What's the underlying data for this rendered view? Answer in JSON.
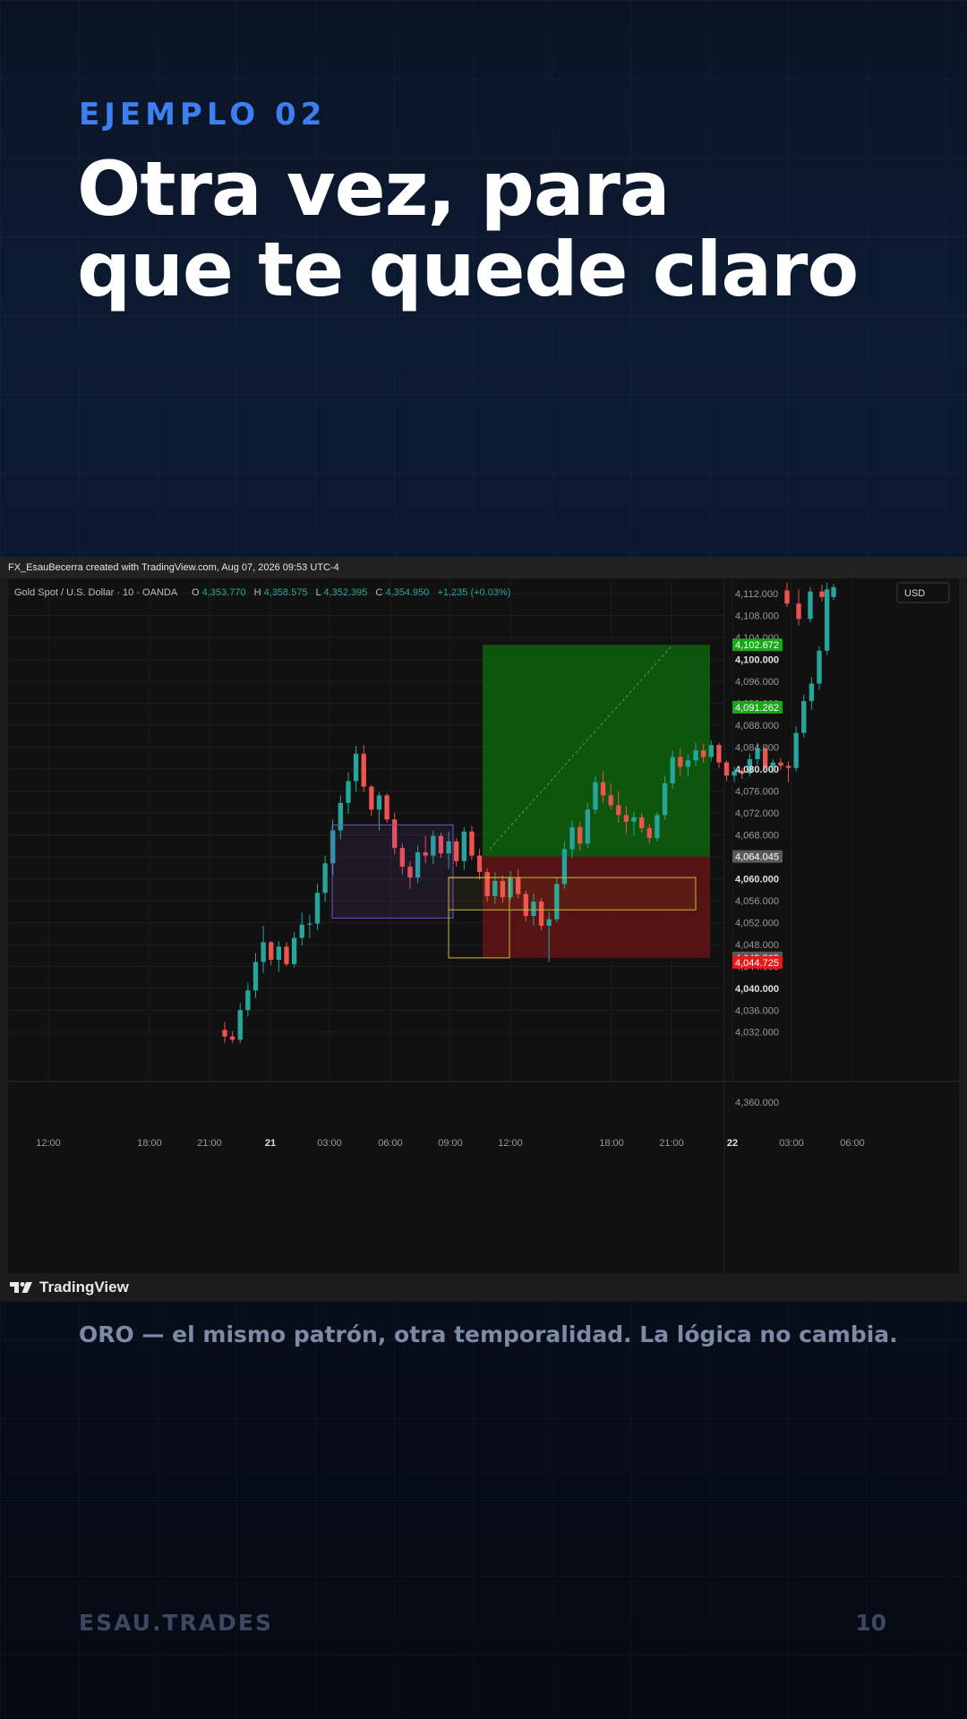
{
  "eyebrow": "EJEMPLO 02",
  "title": {
    "line1": "Otra vez, para",
    "line2": "que te quede claro"
  },
  "caption": "ORO — el mismo patrón, otra temporalidad. La lógica no cambia.",
  "footer": {
    "brand": "ESAU.TRADES",
    "page": "10"
  },
  "tradingview": {
    "created_line": "FX_EsauBecerra created with TradingView.com, Aug 07, 2026 09:53 UTC-4",
    "symbol": "Gold Spot / U.S. Dollar · 10 · OANDA",
    "ohlc": {
      "o_label": "O",
      "o": "4,353.770",
      "h_label": "H",
      "h": "4,358.575",
      "l_label": "L",
      "l": "4,352.395",
      "c_label": "C",
      "c": "4,354.950",
      "change": "+1.235 (+0.03%)"
    },
    "currency": "USD",
    "logo_text": "TradingView",
    "price_axis": [
      "4,112.000",
      "4,108.000",
      "4,104.000",
      "4,100.000",
      "4,096.000",
      "4,092.000",
      "4,088.000",
      "4,084.000",
      "4,080.000",
      "4,076.000",
      "4,072.000",
      "4,068.000",
      "4,064.000",
      "4,060.000",
      "4,056.000",
      "4,052.000",
      "4,048.000",
      "4,044.000",
      "4,040.000",
      "4,036.000",
      "4,032.000"
    ],
    "lower_axis_price": "4,360.000",
    "price_tags": [
      {
        "label": "4,102.672",
        "color": "#1aa81a"
      },
      {
        "label": "4,091.262",
        "color": "#1aa81a"
      },
      {
        "label": "4,064.045",
        "color": "#5a5a5a"
      },
      {
        "label": "4,045.535",
        "color": "#5a5a5a"
      },
      {
        "label": "4,044.725",
        "color": "#e8191a"
      }
    ],
    "time_axis": [
      "12:00",
      "18:00",
      "21:00",
      "21",
      "03:00",
      "06:00",
      "09:00",
      "12:00",
      "18:00",
      "21:00",
      "22",
      "03:00",
      "06:00"
    ],
    "colors": {
      "up": "#26a69a",
      "down": "#ef5350",
      "profit_zone": "#0f5a0f",
      "loss_zone": "#5a1414",
      "range_box": "#7b4fc9",
      "fvg_box": "#c9b74a"
    }
  },
  "chart_data": {
    "type": "candlestick",
    "symbol": "Gold Spot / U.S. Dollar",
    "timeframe": "10",
    "ylim": [
      4030,
      4114
    ],
    "x_ticks": [
      "12:00",
      "18:00",
      "21:00",
      "21",
      "03:00",
      "06:00",
      "09:00",
      "12:00",
      "18:00",
      "21:00",
      "22",
      "03:00",
      "06:00"
    ],
    "position": {
      "entry": 4064.045,
      "take_profit": 4102.672,
      "stop_loss": 4045.535
    },
    "range_box": {
      "high": 4069.8,
      "low": 4052.8
    },
    "fvg_box": {
      "high": 4060.2,
      "low": 4054.3
    },
    "candles": [
      [
        4032.4,
        4033.8,
        4030,
        4031.2
      ],
      [
        4031.2,
        4032.2,
        4030,
        4030.6
      ],
      [
        4030.6,
        4037.2,
        4030,
        4036
      ],
      [
        4036,
        4041,
        4034.8,
        4039.6
      ],
      [
        4039.6,
        4046.4,
        4038.2,
        4044.8
      ],
      [
        4044.8,
        4051.4,
        4042.8,
        4048.4
      ],
      [
        4048.4,
        4048.6,
        4044.2,
        4045.2
      ],
      [
        4045.2,
        4048.6,
        4043,
        4047.6
      ],
      [
        4047.6,
        4048.4,
        4044,
        4044.4
      ],
      [
        4044.4,
        4050.2,
        4043.8,
        4049.2
      ],
      [
        4049.2,
        4053.8,
        4047.8,
        4051.6
      ],
      [
        4051.6,
        4053.4,
        4049.2,
        4051.8
      ],
      [
        4051.8,
        4059,
        4050.6,
        4057.4
      ],
      [
        4057.4,
        4064.2,
        4055.8,
        4062.8
      ],
      [
        4062.8,
        4070.8,
        4060.6,
        4068.8
      ],
      [
        4068.8,
        4075.2,
        4067.2,
        4073.8
      ],
      [
        4073.8,
        4079.4,
        4071.8,
        4077.8
      ],
      [
        4077.8,
        4084.2,
        4075.8,
        4082.8
      ],
      [
        4082.8,
        4084.4,
        4075.8,
        4076.8
      ],
      [
        4076.8,
        4077,
        4071.4,
        4072.6
      ],
      [
        4072.6,
        4075.8,
        4068.8,
        4075.2
      ],
      [
        4075.2,
        4075.6,
        4070.2,
        4070.8
      ],
      [
        4070.8,
        4072,
        4064.4,
        4065.6
      ],
      [
        4065.6,
        4066.4,
        4060.8,
        4062.2
      ],
      [
        4062.2,
        4063.2,
        4058.2,
        4060.2
      ],
      [
        4060.2,
        4066,
        4059.2,
        4064.8
      ],
      [
        4064.8,
        4067.8,
        4062.8,
        4064.2
      ],
      [
        4064.2,
        4068.8,
        4062.6,
        4067.8
      ],
      [
        4067.8,
        4068.4,
        4063.8,
        4064.6
      ],
      [
        4064.6,
        4068.6,
        4061.8,
        4066.8
      ],
      [
        4066.8,
        4067.4,
        4062.2,
        4063.2
      ],
      [
        4063.2,
        4069.4,
        4061.6,
        4068.6
      ],
      [
        4068.6,
        4069.6,
        4063.4,
        4064.2
      ],
      [
        4064.2,
        4065.4,
        4059.8,
        4061.2
      ],
      [
        4061.2,
        4061.8,
        4055.8,
        4056.8
      ],
      [
        4056.8,
        4061.2,
        4055.4,
        4059.6
      ],
      [
        4059.6,
        4060.6,
        4055.6,
        4056.6
      ],
      [
        4056.6,
        4061.4,
        4056.2,
        4060.2
      ],
      [
        4060.2,
        4061.8,
        4056.4,
        4057.2
      ],
      [
        4057.2,
        4057.8,
        4052.2,
        4053.2
      ],
      [
        4053.2,
        4057.2,
        4051.4,
        4055.8
      ],
      [
        4055.8,
        4056.4,
        4050.6,
        4051.4
      ],
      [
        4051.4,
        4054,
        4044.8,
        4052.6
      ],
      [
        4052.6,
        4060.2,
        4052,
        4059
      ],
      [
        4059,
        4066.8,
        4058.2,
        4065.4
      ],
      [
        4065.4,
        4070.6,
        4063.8,
        4069.4
      ],
      [
        4069.4,
        4070.4,
        4065.2,
        4066.4
      ],
      [
        4066.4,
        4073.8,
        4065.6,
        4072.6
      ],
      [
        4072.6,
        4078.8,
        4071.8,
        4077.6
      ],
      [
        4077.6,
        4079.6,
        4073.8,
        4075.2
      ],
      [
        4075.2,
        4077.4,
        4072.6,
        4073.4
      ],
      [
        4073.4,
        4076,
        4070.2,
        4071.6
      ],
      [
        4071.6,
        4073.2,
        4068.2,
        4070.4
      ],
      [
        4070.4,
        4072.2,
        4067.8,
        4071.2
      ],
      [
        4071.2,
        4072,
        4068.4,
        4069.2
      ],
      [
        4069.2,
        4070,
        4066.4,
        4067.4
      ],
      [
        4067.4,
        4072.2,
        4066.8,
        4071.6
      ],
      [
        4071.6,
        4078.8,
        4070.8,
        4077.4
      ],
      [
        4077.4,
        4083.4,
        4076.4,
        4082.2
      ],
      [
        4082.2,
        4083.8,
        4078.8,
        4080.4
      ],
      [
        4080.4,
        4082.6,
        4078.6,
        4081.6
      ],
      [
        4081.6,
        4084.8,
        4080.6,
        4083.4
      ],
      [
        4083.4,
        4084.6,
        4081.2,
        4082.2
      ],
      [
        4082.2,
        4085.2,
        4081.4,
        4084.4
      ],
      [
        4084.4,
        4084.8,
        4080.2,
        4081.2
      ],
      [
        4081.2,
        4081.6,
        4077.8,
        4078.8
      ],
      [
        4078.8,
        4080.4,
        4077.6,
        4079.6
      ],
      [
        4079.6,
        4080.2,
        4078.2,
        4079.2
      ],
      [
        4079.2,
        4082.8,
        4078.6,
        4081.8
      ],
      [
        4081.8,
        4084.8,
        4080.8,
        4083.8
      ],
      [
        4083.8,
        4084.2,
        4079.8,
        4080.4
      ],
      [
        4080.4,
        4081.8,
        4079.2,
        4081.2
      ],
      [
        4081.2,
        4082,
        4079.8,
        4080.6
      ],
      [
        4080.6,
        4081.4,
        4077.6,
        4080.2
      ],
      [
        4080.2,
        4087.8,
        4079.6,
        4086.6
      ],
      [
        4086.6,
        4093.6,
        4085.8,
        4092.4
      ],
      [
        4092.4,
        4096.8,
        4090.8,
        4095.6
      ],
      [
        4095.6,
        4102.4,
        4094.4,
        4101.6
      ],
      [
        4101.6,
        4114,
        4100.8,
        4112.8
      ],
      [
        4112.8,
        4114,
        4110.2,
        4113.2
      ],
      [
        4108.6,
        4113.8,
        4108.2,
        4112.6
      ],
      [
        4112.6,
        4114,
        4109.6,
        4110.2
      ],
      [
        4110.2,
        4112.8,
        4106.2,
        4107.4
      ],
      [
        4107.4,
        4113.2,
        4106.8,
        4112.4
      ],
      [
        4112.4,
        4113.6,
        4110.6,
        4111.4
      ],
      [
        4111.4,
        4113.8,
        4110.8,
        4113.2
      ]
    ]
  }
}
